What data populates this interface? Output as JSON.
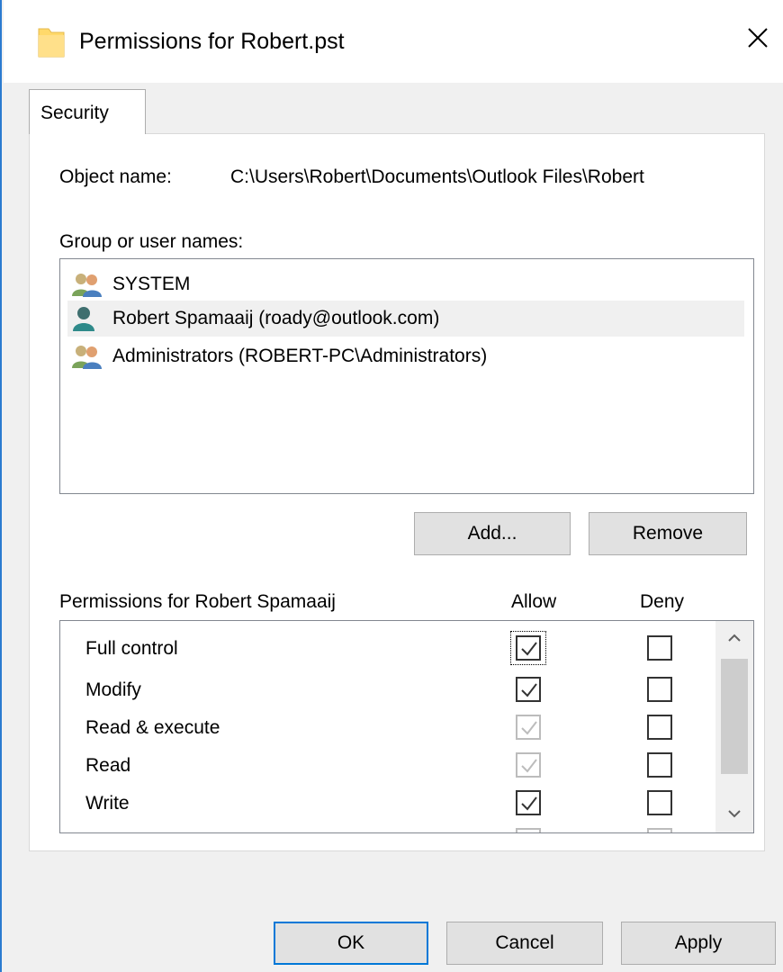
{
  "window": {
    "title": "Permissions for Robert.pst",
    "icon": "folder-icon",
    "close_icon": "close-icon"
  },
  "tabs": [
    {
      "label": "Security"
    }
  ],
  "object": {
    "label": "Object name:",
    "value": "C:\\Users\\Robert\\Documents\\Outlook Files\\Robert"
  },
  "groups": {
    "label": "Group or user names:",
    "items": [
      {
        "name": "SYSTEM",
        "icon": "users-group-icon",
        "selected": false
      },
      {
        "name": "Robert Spamaaij (roady@outlook.com)",
        "icon": "user-icon",
        "selected": true
      },
      {
        "name": "Administrators (ROBERT-PC\\Administrators)",
        "icon": "users-group-icon",
        "selected": false
      }
    ],
    "add_label": "Add...",
    "remove_label": "Remove"
  },
  "permissions": {
    "label": "Permissions for Robert Spamaaij",
    "allow_header": "Allow",
    "deny_header": "Deny",
    "rows": [
      {
        "name": "Full control",
        "allow": true,
        "allow_disabled": false,
        "deny": false
      },
      {
        "name": "Modify",
        "allow": true,
        "allow_disabled": false,
        "deny": false
      },
      {
        "name": "Read & execute",
        "allow": true,
        "allow_disabled": true,
        "deny": false
      },
      {
        "name": "Read",
        "allow": true,
        "allow_disabled": true,
        "deny": false
      },
      {
        "name": "Write",
        "allow": true,
        "allow_disabled": false,
        "deny": false
      }
    ]
  },
  "footer": {
    "ok_label": "OK",
    "cancel_label": "Cancel",
    "apply_label": "Apply"
  },
  "colors": {
    "accent": "#0078d7",
    "selection": "#f0f0f0",
    "folder": "#ffd96b"
  }
}
